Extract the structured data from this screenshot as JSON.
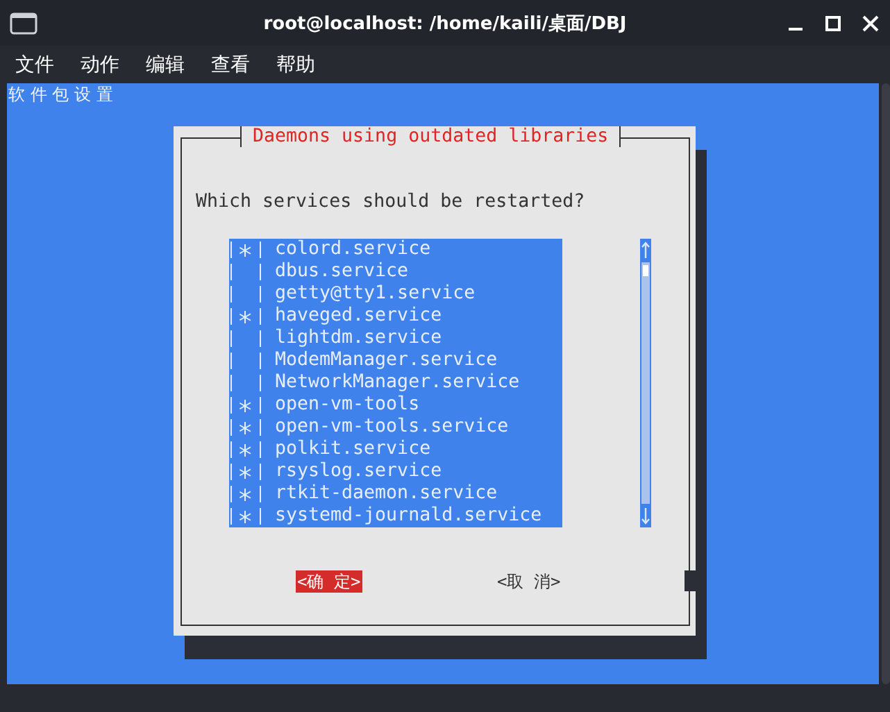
{
  "window": {
    "title": "root@localhost: /home/kaili/桌面/DBJ"
  },
  "menu": [
    "文件",
    "动作",
    "编辑",
    "查看",
    "帮助"
  ],
  "terminal": {
    "backtitle": "软 件 包 设 置",
    "dialog": {
      "title": "Daemons using outdated libraries",
      "prompt": "Which services should be restarted?",
      "items": [
        {
          "label": "colord.service",
          "checked": true
        },
        {
          "label": "dbus.service",
          "checked": false
        },
        {
          "label": "getty@tty1.service",
          "checked": false
        },
        {
          "label": "haveged.service",
          "checked": true
        },
        {
          "label": "lightdm.service",
          "checked": false
        },
        {
          "label": "ModemManager.service",
          "checked": false
        },
        {
          "label": "NetworkManager.service",
          "checked": false
        },
        {
          "label": "open-vm-tools",
          "checked": true
        },
        {
          "label": "open-vm-tools.service",
          "checked": true
        },
        {
          "label": "polkit.service",
          "checked": true
        },
        {
          "label": "rsyslog.service",
          "checked": true
        },
        {
          "label": "rtkit-daemon.service",
          "checked": true
        },
        {
          "label": "systemd-journald.service",
          "checked": true
        }
      ],
      "buttons": [
        {
          "label": "<确 定>",
          "selected": true
        },
        {
          "label": "<取 消>",
          "selected": false
        }
      ]
    }
  }
}
